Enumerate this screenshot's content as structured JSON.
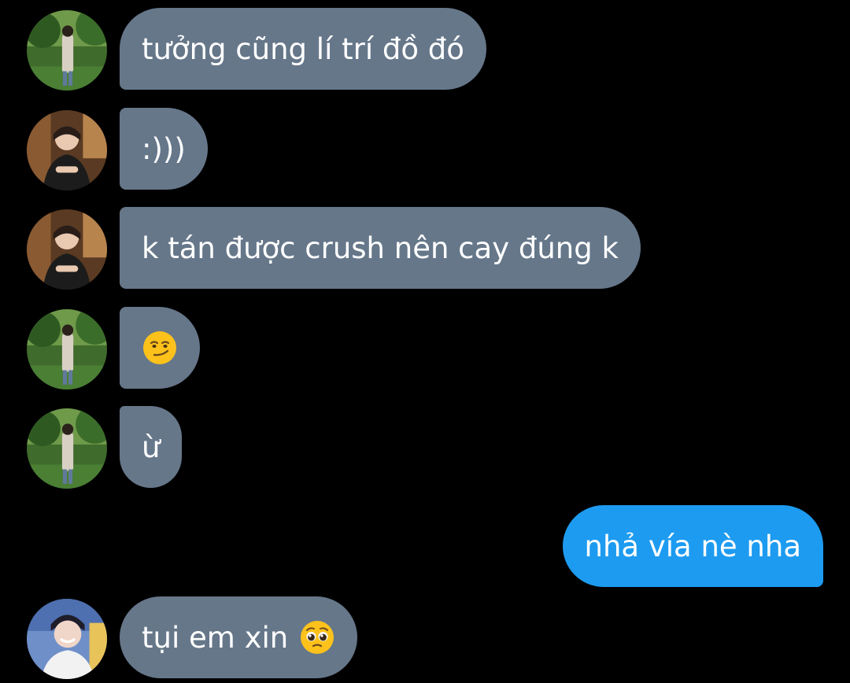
{
  "messages": [
    {
      "sender": "them",
      "avatar": "avatar-park",
      "text": "tưởng cũng lí trí đồ đó"
    },
    {
      "sender": "them",
      "avatar": "avatar-cafe",
      "text": ":)))"
    },
    {
      "sender": "them",
      "avatar": "avatar-cafe",
      "text": "k tán được crush nên cay đúng k"
    },
    {
      "sender": "them",
      "avatar": "avatar-park",
      "text": "",
      "emoji": "smirking-face-emoji"
    },
    {
      "sender": "them",
      "avatar": "avatar-park",
      "text": "ừ"
    },
    {
      "sender": "me",
      "text": "nhả vía nè nha"
    },
    {
      "sender": "them",
      "avatar": "avatar-smile",
      "text": "tụi em xin",
      "emoji": "pleading-face-emoji"
    }
  ],
  "colors": {
    "background": "#000000",
    "incoming_bubble": "#66778a",
    "outgoing_bubble": "#1d9bf0",
    "text": "#ffffff"
  }
}
